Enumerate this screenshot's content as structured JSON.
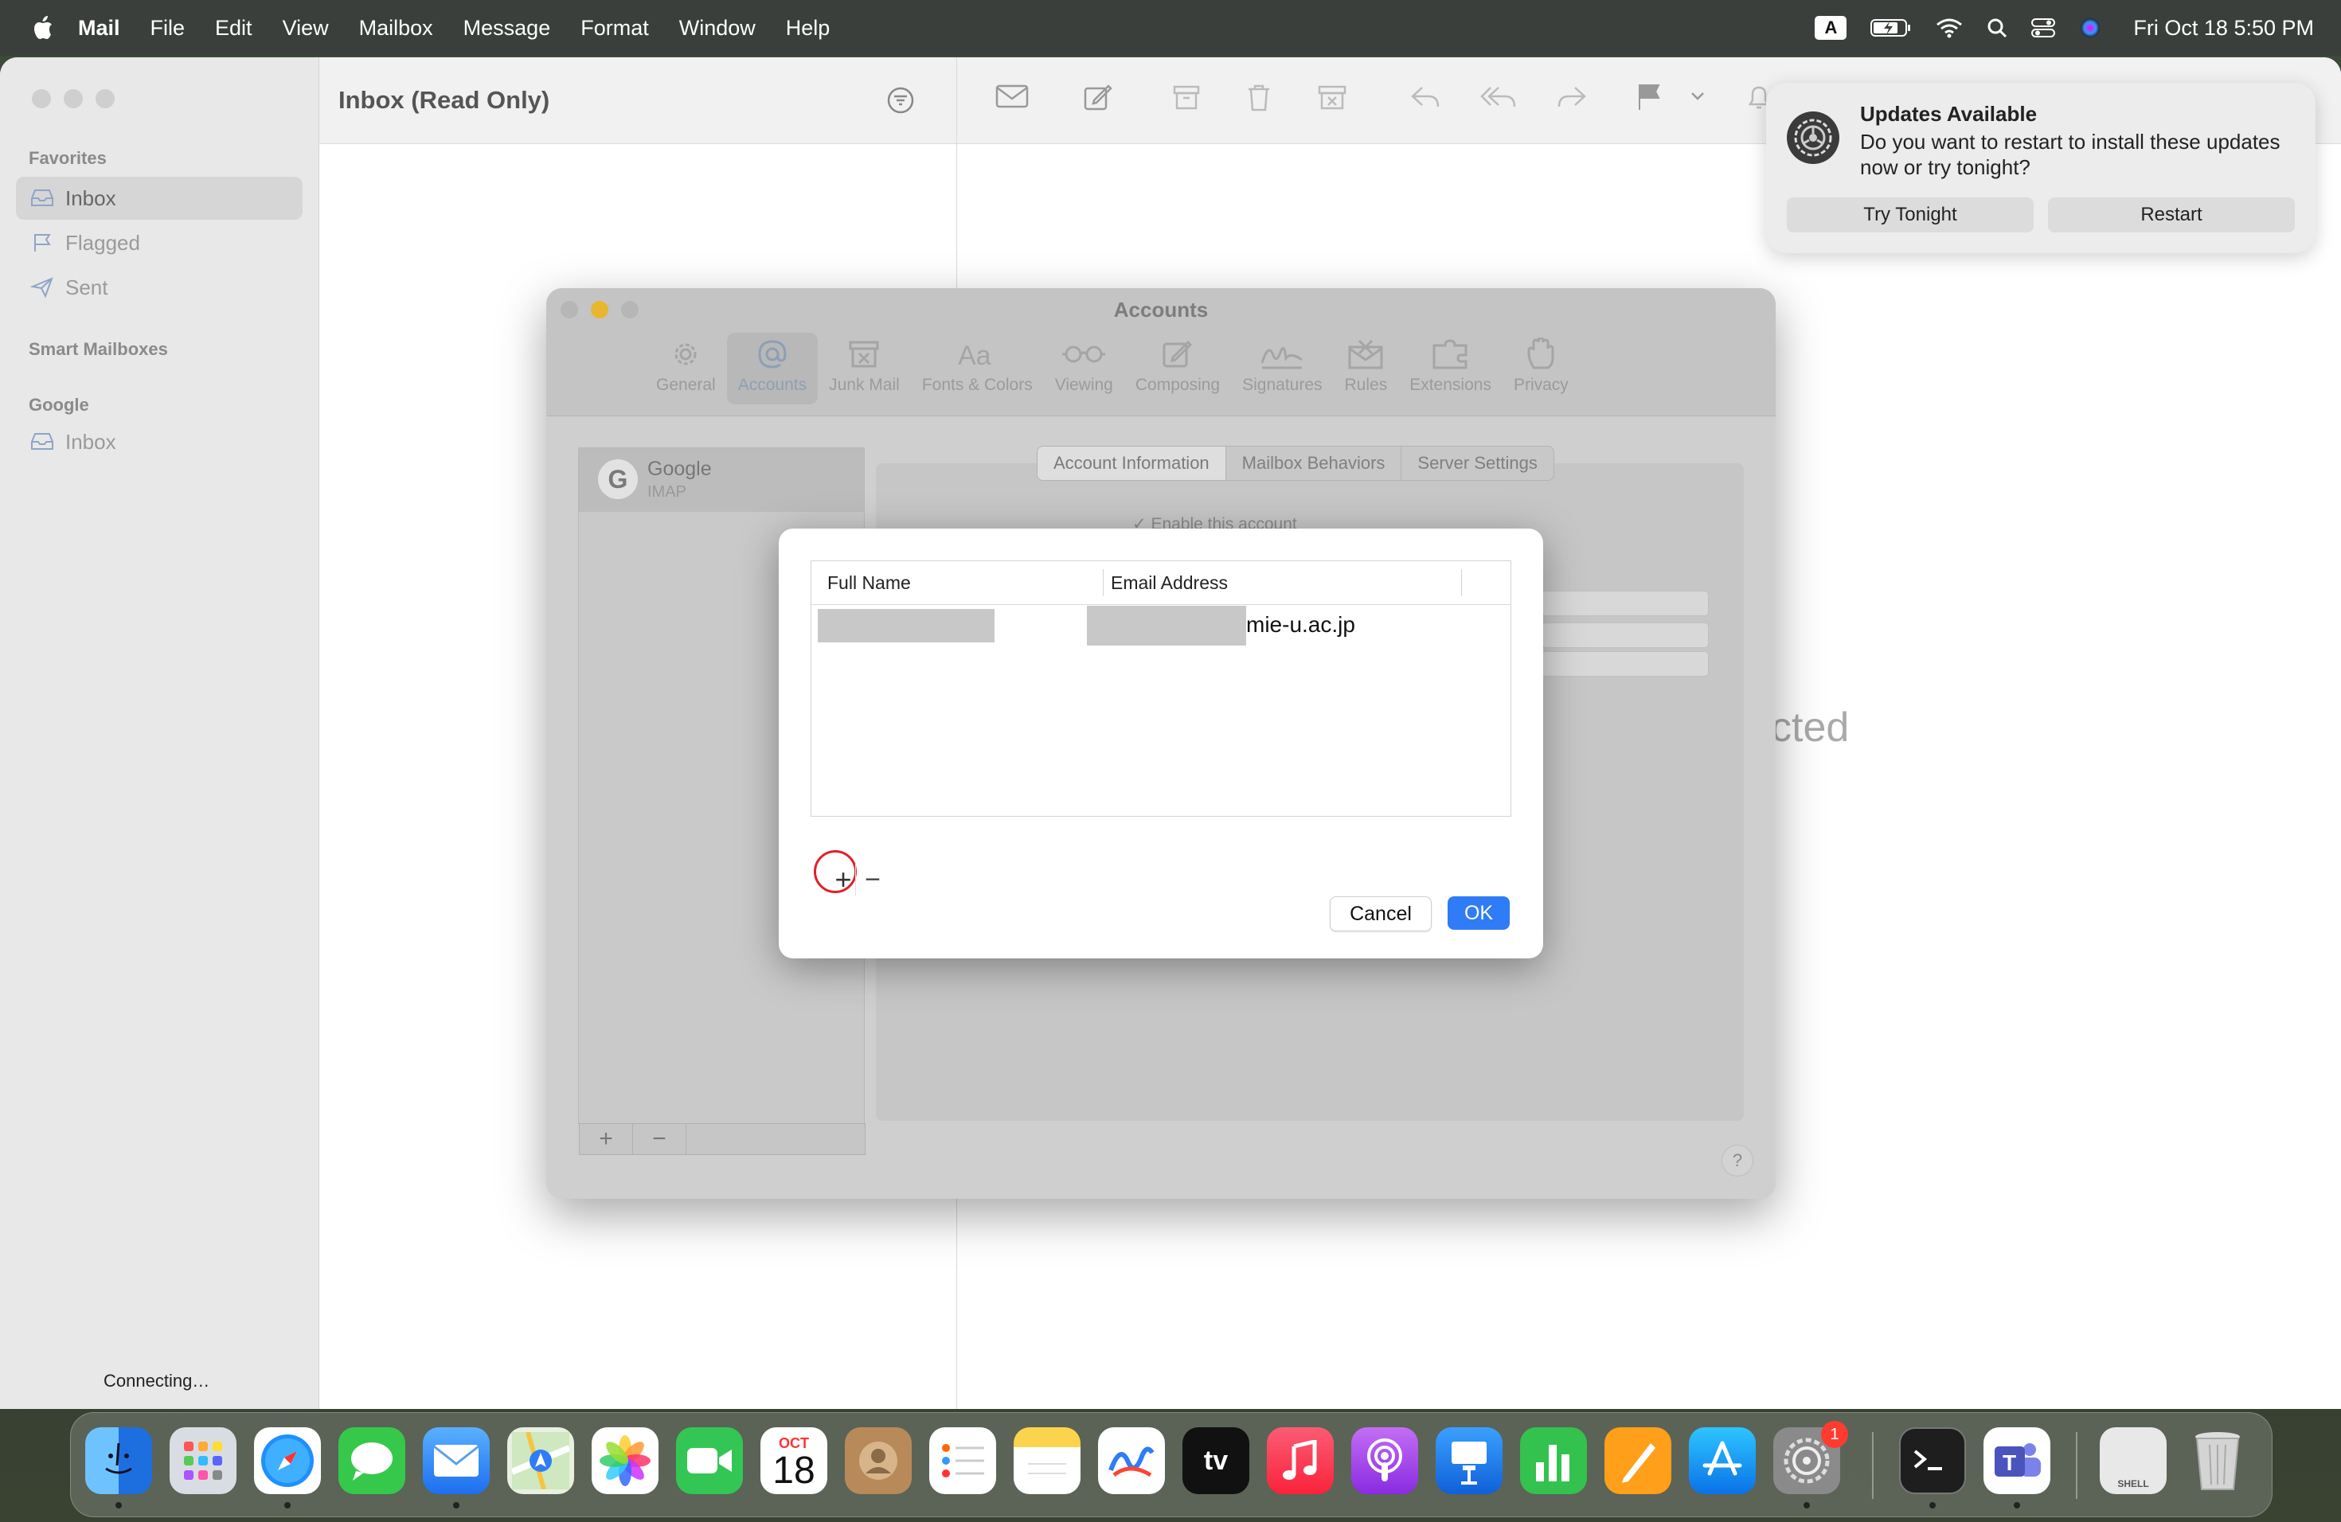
{
  "menubar": {
    "app": "Mail",
    "items": [
      "File",
      "Edit",
      "View",
      "Mailbox",
      "Message",
      "Format",
      "Window",
      "Help"
    ],
    "input_source": "A",
    "clock": "Fri Oct 18  5:50 PM"
  },
  "sidebar": {
    "favorites_label": "Favorites",
    "favorites": [
      "Inbox",
      "Flagged",
      "Sent"
    ],
    "smart_label": "Smart Mailboxes",
    "google_label": "Google",
    "google_items": [
      "Inbox"
    ],
    "status": "Connecting…"
  },
  "list": {
    "title": "Inbox (Read Only)"
  },
  "viewer": {
    "no_selection_text": "cted"
  },
  "accounts_window": {
    "title": "Accounts",
    "tabs": [
      "General",
      "Accounts",
      "Junk Mail",
      "Fonts & Colors",
      "Viewing",
      "Composing",
      "Signatures",
      "Rules",
      "Extensions",
      "Privacy"
    ],
    "account": {
      "name": "Google",
      "type": "IMAP"
    },
    "segments": [
      "Account Information",
      "Mailbox Behaviors",
      "Server Settings"
    ],
    "enable_label": "Enable this account",
    "help": "?"
  },
  "sheet": {
    "col_full_name": "Full Name",
    "col_email": "Email Address",
    "email_suffix": "mie-u.ac.jp",
    "add": "+",
    "remove": "−",
    "cancel": "Cancel",
    "ok": "OK"
  },
  "notification": {
    "title": "Updates Available",
    "body": "Do you want to restart to install these updates now or try tonight?",
    "btn_tonight": "Try Tonight",
    "btn_restart": "Restart"
  },
  "dock": {
    "calendar_month": "OCT",
    "calendar_day": "18",
    "tv_label": "tv",
    "settings_badge": "1",
    "shell_label": "SHELL"
  },
  "colors": {
    "accent": "#2f7cf6",
    "highlight_ring": "#e0202a"
  }
}
